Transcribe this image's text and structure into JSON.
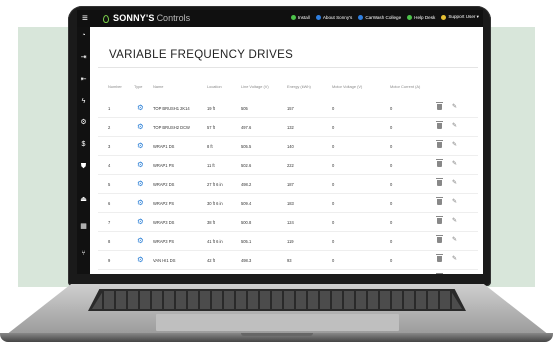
{
  "app": {
    "brand_main": "SONNY'S",
    "brand_sub": "Controls",
    "menu_glyph": "≡"
  },
  "toplinks": [
    {
      "label": "Install",
      "icon": "install-icon",
      "color": "#4cc24a"
    },
    {
      "label": "About Sonny's",
      "icon": "info-icon",
      "color": "#2f7fe0"
    },
    {
      "label": "CarWash College",
      "icon": "college-icon",
      "color": "#2f7fe0"
    },
    {
      "label": "Help Desk",
      "icon": "help-icon",
      "color": "#4cc24a"
    },
    {
      "label": "Support User ▾",
      "icon": "user-icon",
      "color": "#e6c033"
    }
  ],
  "sidebar_icons": [
    {
      "name": "dashboard-icon",
      "glyph": "◔"
    },
    {
      "name": "login-icon",
      "glyph": "⇥"
    },
    {
      "name": "logout-icon",
      "glyph": "⇤"
    },
    {
      "name": "lightning-icon",
      "glyph": "ϟ"
    },
    {
      "name": "settings-icon",
      "glyph": "⚙"
    },
    {
      "name": "dollar-icon",
      "glyph": "$"
    },
    {
      "name": "shield-icon",
      "glyph": "⛊"
    },
    {
      "name": "car-icon",
      "glyph": "⏏"
    },
    {
      "name": "grid-icon",
      "glyph": "▦"
    },
    {
      "name": "network-icon",
      "glyph": "⑂"
    }
  ],
  "page": {
    "title": "VARIABLE FREQUENCY DRIVES"
  },
  "table": {
    "columns": [
      "Number",
      "Type",
      "Name",
      "Location",
      "Line Voltage (V)",
      "Energy (kWh)",
      "Motor Voltage (V)",
      "Motor Current (A)"
    ],
    "rows": [
      {
        "number": "1",
        "name": "TOP BRUSH1 2K14",
        "location": "19 ft",
        "line_voltage": "505",
        "energy": "157",
        "motor_voltage": "0",
        "motor_current": "0"
      },
      {
        "number": "2",
        "name": "TOP BRUSH2 DCW",
        "location": "57 ft",
        "line_voltage": "497.6",
        "energy": "132",
        "motor_voltage": "0",
        "motor_current": "0"
      },
      {
        "number": "3",
        "name": "WRAP1 DS",
        "location": "8 ft",
        "line_voltage": "505.5",
        "energy": "140",
        "motor_voltage": "0",
        "motor_current": "0"
      },
      {
        "number": "4",
        "name": "WRAP1 PS",
        "location": "11 ft",
        "line_voltage": "502.6",
        "energy": "222",
        "motor_voltage": "0",
        "motor_current": "0"
      },
      {
        "number": "5",
        "name": "WRAP2 DS",
        "location": "27 ft 6 in",
        "line_voltage": "498.2",
        "energy": "187",
        "motor_voltage": "0",
        "motor_current": "0"
      },
      {
        "number": "6",
        "name": "WRAP2 PS",
        "location": "30 ft 6 in",
        "line_voltage": "509.4",
        "energy": "183",
        "motor_voltage": "0",
        "motor_current": "0"
      },
      {
        "number": "7",
        "name": "WRAP3 DS",
        "location": "38 ft",
        "line_voltage": "500.8",
        "energy": "124",
        "motor_voltage": "0",
        "motor_current": "0"
      },
      {
        "number": "8",
        "name": "WRAP3 PS",
        "location": "41 ft 6 in",
        "line_voltage": "505.1",
        "energy": "119",
        "motor_voltage": "0",
        "motor_current": "0"
      },
      {
        "number": "9",
        "name": "VAN HI1 DS",
        "location": "42 ft",
        "line_voltage": "498.3",
        "energy": "93",
        "motor_voltage": "0",
        "motor_current": "0"
      },
      {
        "number": "10",
        "name": "VAN HI1 PS",
        "location": "43 ft",
        "line_voltage": "503.7",
        "energy": "103",
        "motor_voltage": "0",
        "motor_current": "0"
      }
    ],
    "type_icon": "gears-icon",
    "row_actions": [
      "delete-icon",
      "edit-icon"
    ]
  }
}
